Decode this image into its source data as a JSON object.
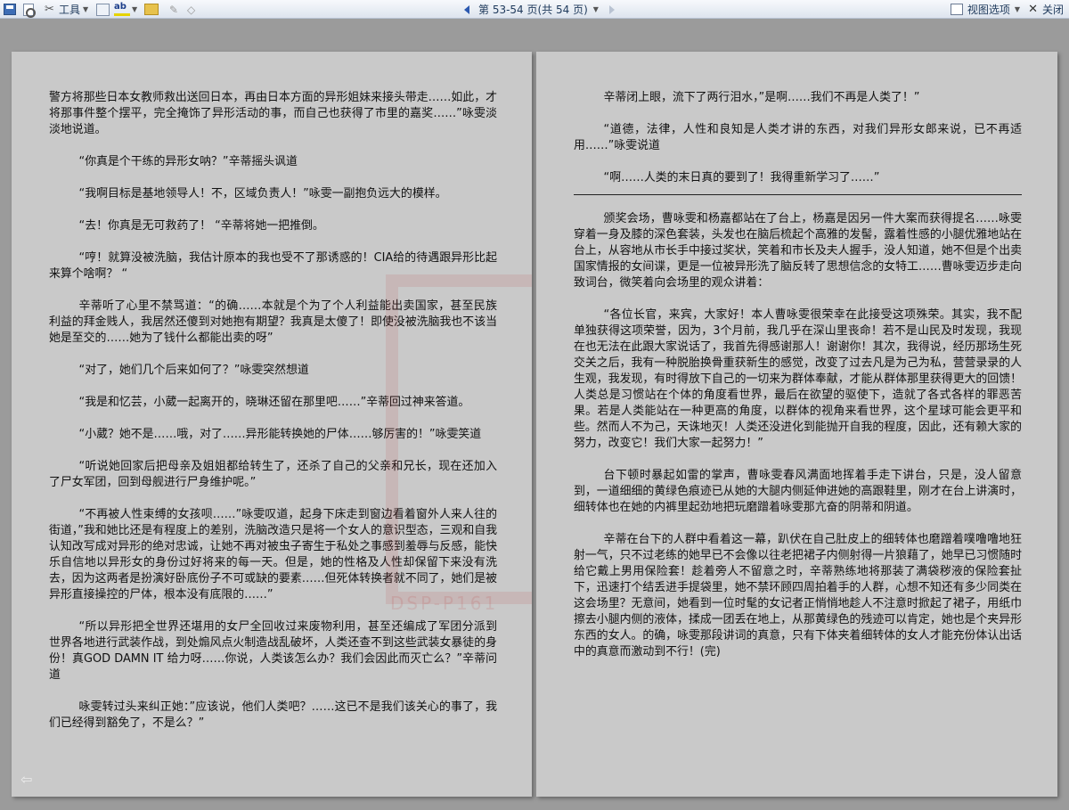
{
  "toolbar": {
    "tools_label": "工具",
    "page_indicator": "第 53-54 页(共 54 页)",
    "view_options_label": "视图选项",
    "close_label": "关闭"
  },
  "left_page": {
    "paragraphs": [
      "警方将那些日本女教师救出送回日本，再由日本方面的异形姐妹来接头带走……如此，才将那事件整个摆平，完全掩饰了异形活动的事，而自己也获得了市里的嘉奖……”咏雯淡淡地说道。",
      "“你真是个干练的异形女呐？”辛蒂摇头讽道",
      "“我啊目标是基地领导人！不，区域负责人！”咏雯一副抱负远大的模样。",
      "“去！你真是无可救药了！ “辛蒂将她一把推倒。",
      "“哼！就算没被洗脑，我估计原本的我也受不了那诱惑的！CIA给的待遇跟异形比起来算个啥啊？ “",
      "辛蒂听了心里不禁骂道：“的确……本就是个为了个人利益能出卖国家，甚至民族利益的拜金贱人，我居然还傻到对她抱有期望？我真是太傻了！即使没被洗脑我也不该当她是至交的……她为了钱什么都能出卖的呀”",
      "“对了，她们几个后来如何了？”咏雯突然想道",
      "“我是和忆芸，小葳一起离开的，晓琳还留在那里吧……”辛蒂回过神来答道。",
      "“小葳？她不是……哦，对了……异形能转换她的尸体……够厉害的！”咏雯笑道",
      "“听说她回家后把母亲及姐姐都给转生了，还杀了自己的父亲和兄长，现在还加入了尸女军团，回到母舰进行尸身维护呢。”",
      "“不再被人性束缚的女孩呗……”咏雯叹道，起身下床走到窗边看着窗外人来人往的街道，”我和她比还是有程度上的差别，洗脑改造只是将一个女人的意识型态，三观和自我认知改写成对异形的绝对忠诚，让她不再对被虫子寄生于私处之事感到羞辱与反感，能快乐自信地以异形女的身份过好将来的每一天。但是，她的性格及人性却保留下来没有洗去，因为这两者是扮演好卧底份子不可或缺的要素……但死体转换者就不同了，她们是被异形直接操控的尸体，根本没有底限的……”",
      "“所以异形把全世界还堪用的女尸全回收过来废物利用，甚至还编成了军团分派到世界各地进行武装作战，到处煽风点火制造战乱破坏，人类还查不到这些武装女暴徒的身份！真GOD DAMN IT 给力呀……你说，人类该怎么办？我们会因此而灭亡么？”辛蒂问道",
      "咏雯转过头来纠正她：”应该说，他们人类吧？……这已不是我们该关心的事了，我们已经得到豁免了，不是么？”"
    ]
  },
  "right_page": {
    "paragraphs_before_rule": [
      "辛蒂闭上眼，流下了两行泪水，”是啊……我们不再是人类了！”",
      "“道德，法律，人性和良知是人类才讲的东西，对我们异形女郎来说，已不再适用……”咏雯说道",
      "“啊……人类的末日真的要到了！我得重新学习了……”"
    ],
    "paragraphs_after_rule": [
      "颁奖会场，曹咏雯和杨嘉都站在了台上，杨嘉是因另一件大案而获得提名……咏雯穿着一身及膝的深色套装，头发也在脑后梳起个高雅的发髻，露着性感的小腿优雅地站在台上，从容地从市长手中接过奖状，笑着和市长及夫人握手，没人知道，她不但是个出卖国家情报的女间谍，更是一位被异形洗了脑反转了思想信念的女特工……曹咏雯迈步走向致词台，微笑着向会场里的观众讲着：",
      "“各位长官，来宾，大家好！本人曹咏雯很荣幸在此接受这项殊荣。其实，我不配单独获得这项荣誉，因为，3个月前，我几乎在深山里丧命！若不是山民及时发现，我现在也无法在此跟大家说话了，我首先得感谢那人！谢谢你！其次，我得说，经历那场生死交关之后，我有一种脱胎换骨重获新生的感觉，改变了过去凡是为己为私，营营录录的人生观，我发现，有时得放下自己的一切来为群体奉献，才能从群体那里获得更大的回馈！人类总是习惯站在个体的角度看世界，最后在欲望的驱使下，造就了各式各样的罪恶苦果。若是人类能站在一种更高的角度，以群体的视角来看世界，这个星球可能会更平和些。然而人不为己，天诛地灭！人类还没进化到能抛开自我的程度，因此，还有赖大家的努力，改变它！我们大家一起努力！”",
      "台下顿时暴起如雷的掌声，曹咏雯春风满面地挥着手走下讲台，只是，没人留意到，一道细细的黄绿色痕迹已从她的大腿内侧延伸进她的高跟鞋里，刚才在台上讲演时，细转体也在她的内裤里起劲地把玩磨蹭着咏雯那亢奋的阴蒂和阴道。",
      "辛蒂在台下的人群中看着这一幕，趴伏在自己肚皮上的细转体也磨蹭着噗噜噜地狂射一气，只不过老练的她早已不会像以往老把裙子内侧射得一片狼藉了，她早已习惯随时给它戴上男用保险套！趁着旁人不留意之时，辛蒂熟练地将那装了满袋秽液的保险套扯下，迅速打个结丢进手提袋里，她不禁环顾四周拍着手的人群，心想不知还有多少同类在这会场里？无意间，她看到一位时髦的女记者正悄悄地趁人不注意时掀起了裙子，用纸巾擦去小腿内侧的液体，揉成一团丢在地上，从那黄绿色的残迹可以肯定，她也是个夹异形东西的女人。的确，咏雯那段讲词的真意，只有下体夹着细转体的女人才能充份体认出话中的真意而激动到不行！(完)"
    ]
  },
  "watermark_text": "DSP-P161",
  "colors": {
    "page_bg": "#c9c9c9",
    "desktop_bg": "#9b9b9b",
    "toolbar_bg": "#dde4ee",
    "watermark": "#be3c3c"
  }
}
